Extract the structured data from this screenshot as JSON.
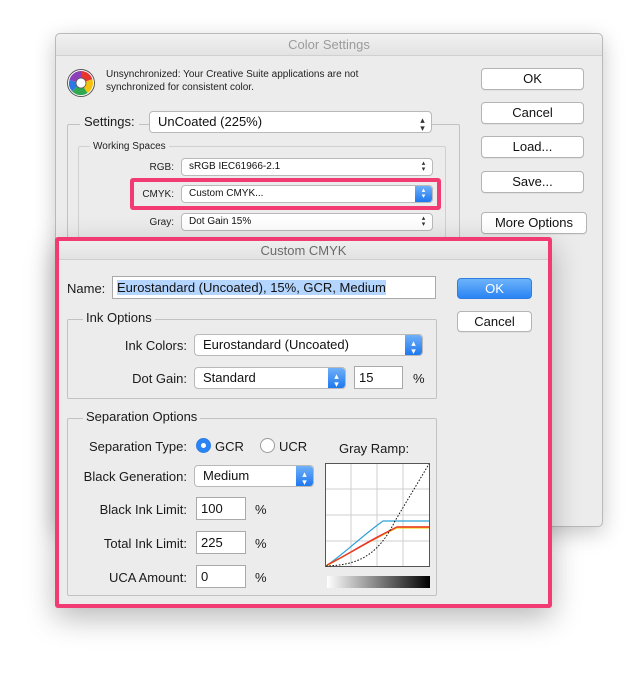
{
  "color_settings": {
    "title": "Color Settings",
    "warning": "Unsynchronized: Your Creative Suite applications are not synchronized for consistent color.",
    "buttons": {
      "ok": "OK",
      "cancel": "Cancel",
      "load": "Load...",
      "save": "Save...",
      "more_options": "More Options"
    },
    "settings_label": "Settings:",
    "settings_value": "UnCoated (225%)",
    "working_spaces_label": "Working Spaces",
    "rgb_label": "RGB:",
    "rgb_value": "sRGB IEC61966-2.1",
    "cmyk_label": "CMYK:",
    "cmyk_value": "Custom CMYK...",
    "gray_label": "Gray:",
    "gray_value": "Dot Gain 15%"
  },
  "custom_cmyk": {
    "title": "Custom CMYK",
    "name_label": "Name:",
    "name_value": "Eurostandard (Uncoated), 15%, GCR, Medium",
    "ok": "OK",
    "cancel": "Cancel",
    "ink_options_label": "Ink Options",
    "ink_colors_label": "Ink Colors:",
    "ink_colors_value": "Eurostandard (Uncoated)",
    "dot_gain_label": "Dot Gain:",
    "dot_gain_value": "Standard",
    "dot_gain_percent": "15",
    "percent": "%",
    "separation_options_label": "Separation Options",
    "separation_type_label": "Separation Type:",
    "gcr_label": "GCR",
    "ucr_label": "UCR",
    "separation_type_selected": "GCR",
    "gray_ramp_label": "Gray Ramp:",
    "black_generation_label": "Black Generation:",
    "black_generation_value": "Medium",
    "black_ink_limit_label": "Black Ink Limit:",
    "black_ink_limit_value": "100",
    "total_ink_limit_label": "Total Ink Limit:",
    "total_ink_limit_value": "225",
    "uca_amount_label": "UCA Amount:",
    "uca_amount_value": "0"
  },
  "colors": {
    "highlight": "#f23b73",
    "accent": "#2a84f4"
  },
  "icons": {
    "logo": "color-wheel-icon",
    "popup": "popup-arrows-icon"
  }
}
